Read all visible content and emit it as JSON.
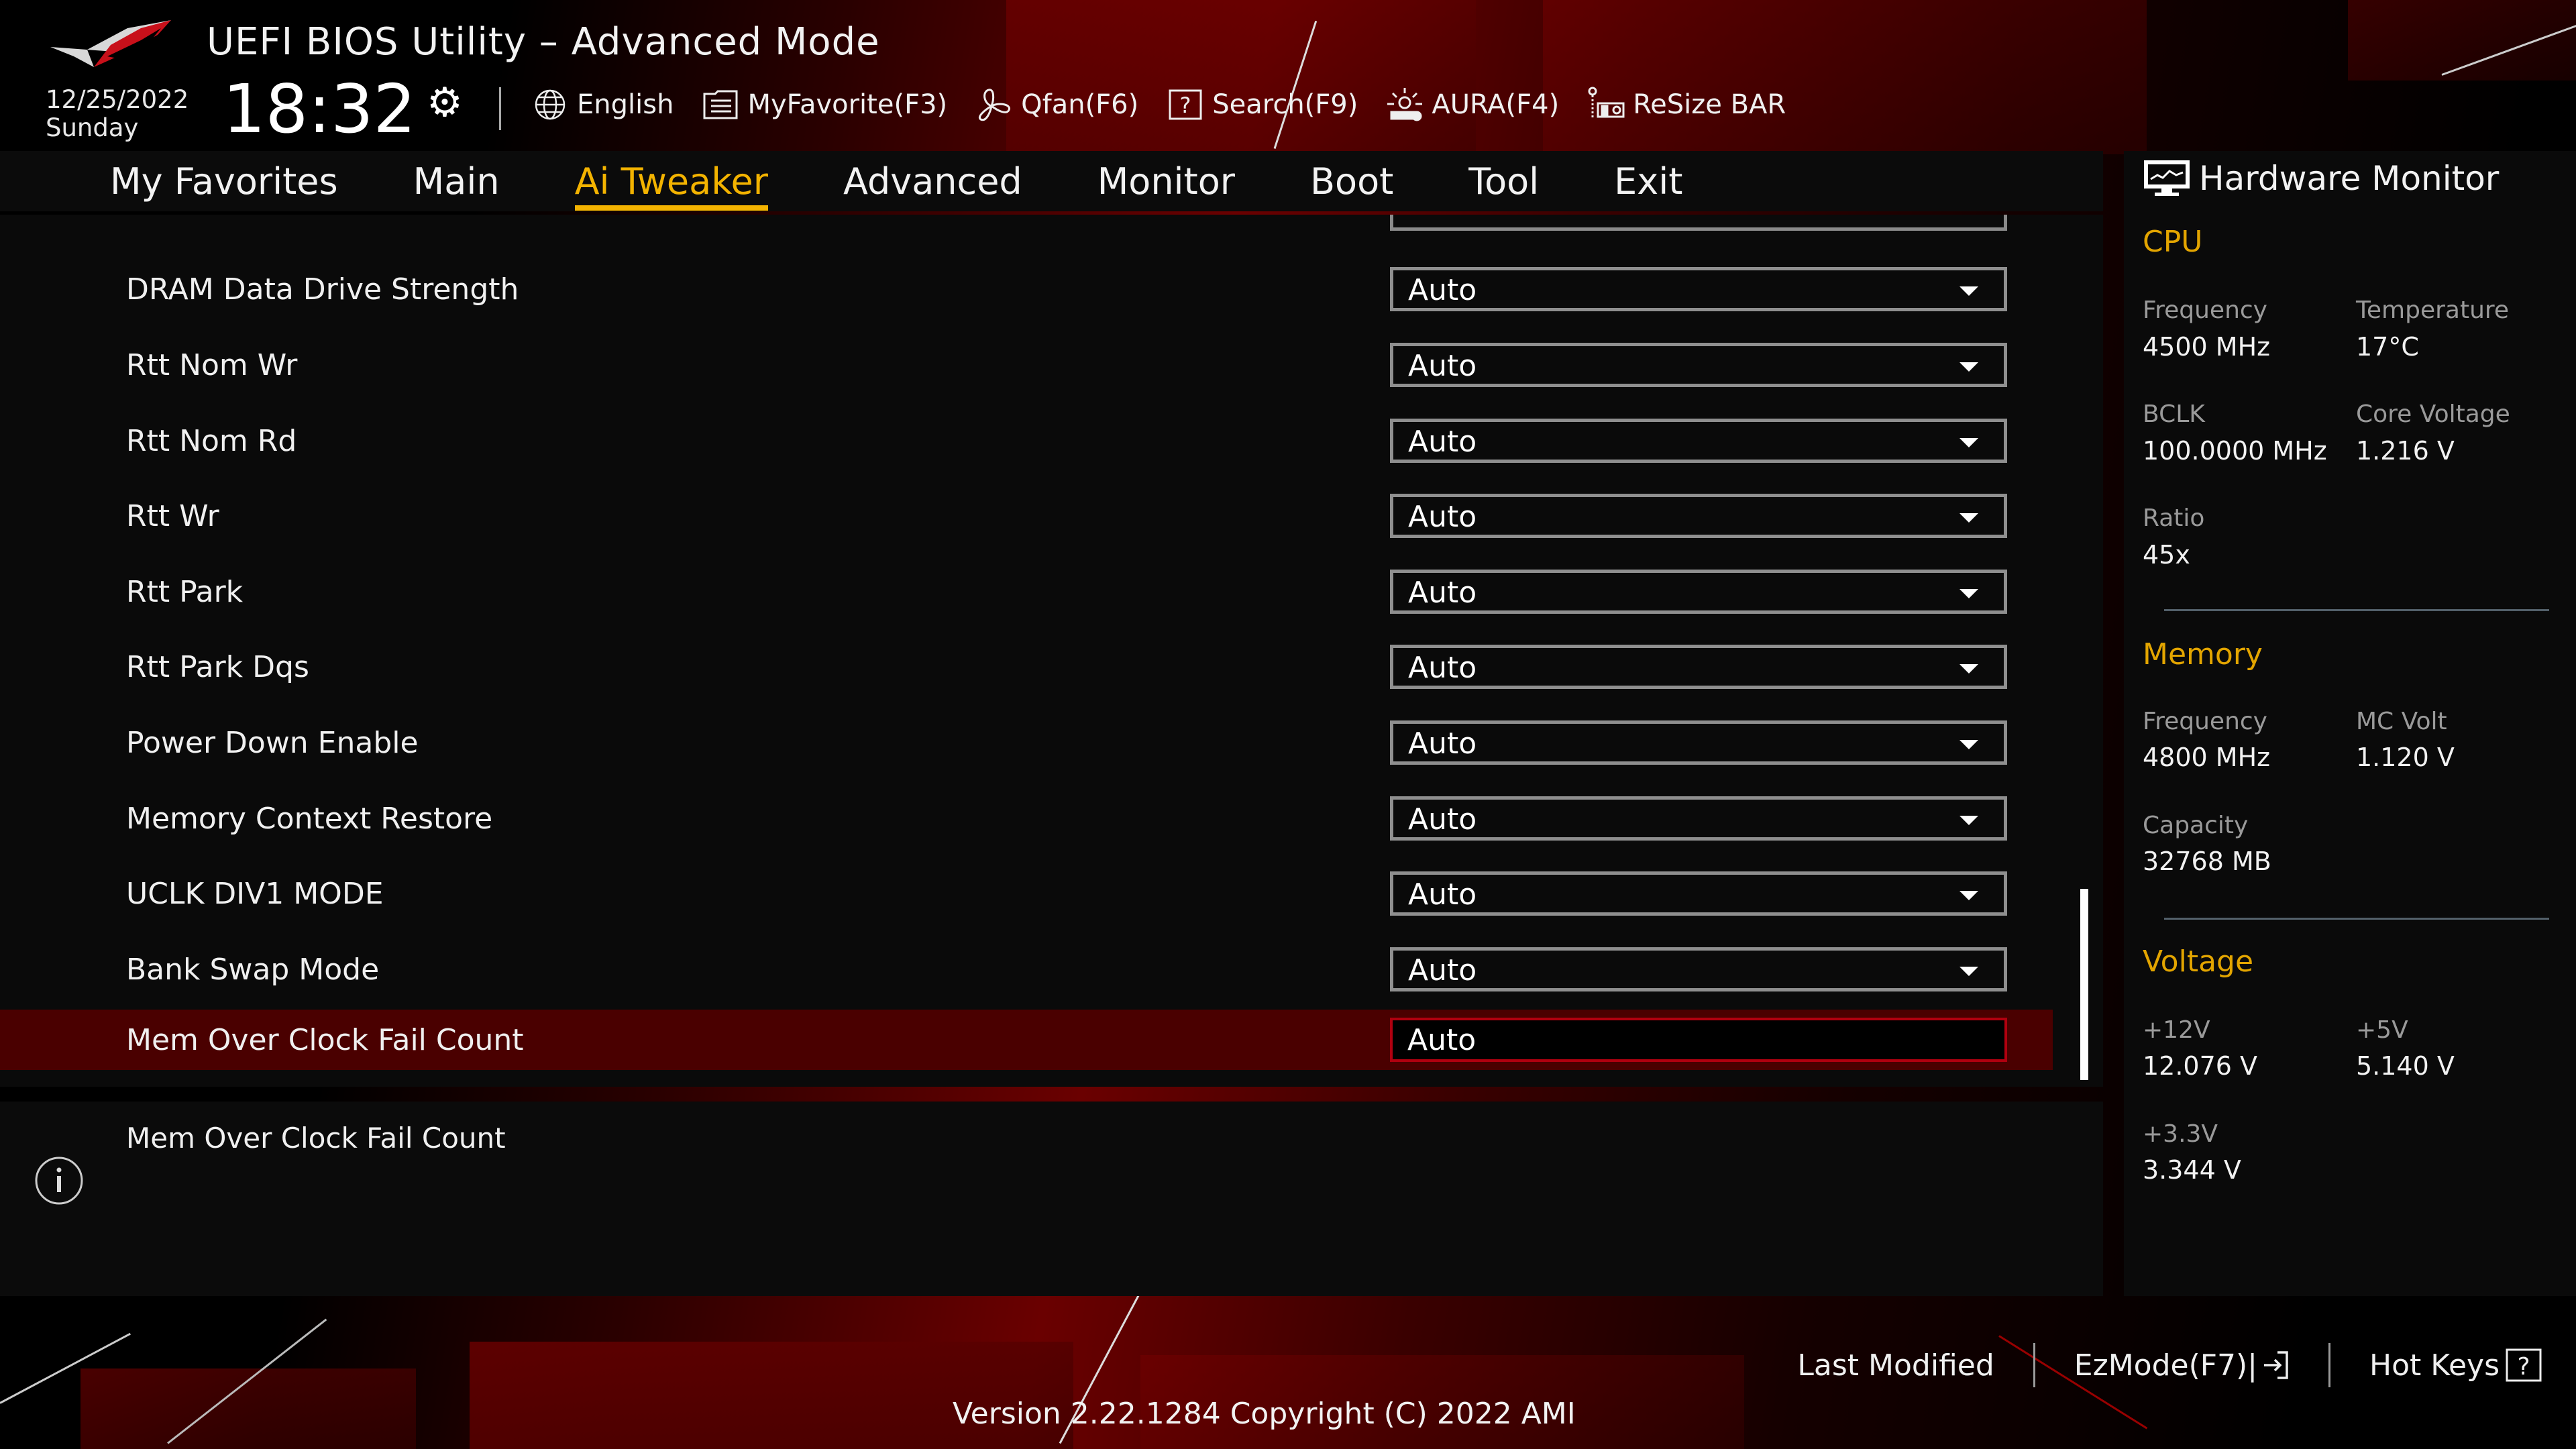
{
  "header": {
    "title": "UEFI BIOS Utility – Advanced Mode",
    "date": "12/25/2022",
    "day": "Sunday",
    "time": "18:32",
    "toolbar": [
      {
        "label": "English",
        "icon": "globe-icon"
      },
      {
        "label": "MyFavorite(F3)",
        "icon": "favorite-list-icon"
      },
      {
        "label": "Qfan(F6)",
        "icon": "fan-icon"
      },
      {
        "label": "Search(F9)",
        "icon": "search-help-icon"
      },
      {
        "label": "AURA(F4)",
        "icon": "aura-light-icon"
      },
      {
        "label": "ReSize BAR",
        "icon": "resize-bar-icon"
      }
    ]
  },
  "nav": {
    "tabs": [
      {
        "label": "My Favorites",
        "active": false
      },
      {
        "label": "Main",
        "active": false
      },
      {
        "label": "Ai Tweaker",
        "active": true
      },
      {
        "label": "Advanced",
        "active": false
      },
      {
        "label": "Monitor",
        "active": false
      },
      {
        "label": "Boot",
        "active": false
      },
      {
        "label": "Tool",
        "active": false
      },
      {
        "label": "Exit",
        "active": false
      }
    ]
  },
  "settings": [
    {
      "label": "DRAM Data Drive Strength",
      "value": "Auto",
      "type": "dropdown"
    },
    {
      "label": "Rtt Nom Wr",
      "value": "Auto",
      "type": "dropdown"
    },
    {
      "label": "Rtt Nom Rd",
      "value": "Auto",
      "type": "dropdown"
    },
    {
      "label": "Rtt Wr",
      "value": "Auto",
      "type": "dropdown"
    },
    {
      "label": "Rtt Park",
      "value": "Auto",
      "type": "dropdown"
    },
    {
      "label": "Rtt Park Dqs",
      "value": "Auto",
      "type": "dropdown"
    },
    {
      "label": "Power Down Enable",
      "value": "Auto",
      "type": "dropdown"
    },
    {
      "label": "Memory Context Restore",
      "value": "Auto",
      "type": "dropdown"
    },
    {
      "label": "UCLK DIV1 MODE",
      "value": "Auto",
      "type": "dropdown"
    },
    {
      "label": "Bank Swap Mode",
      "value": "Auto",
      "type": "dropdown"
    },
    {
      "label": "Mem Over Clock Fail Count",
      "value": "Auto",
      "type": "input",
      "selected": true
    }
  ],
  "help": {
    "text": "Mem Over Clock Fail Count"
  },
  "hardware_monitor": {
    "title": "Hardware Monitor",
    "cpu": {
      "heading": "CPU",
      "frequency_label": "Frequency",
      "frequency": "4500 MHz",
      "temperature_label": "Temperature",
      "temperature": "17°C",
      "bclk_label": "BCLK",
      "bclk": "100.0000 MHz",
      "core_voltage_label": "Core Voltage",
      "core_voltage": "1.216 V",
      "ratio_label": "Ratio",
      "ratio": "45x"
    },
    "memory": {
      "heading": "Memory",
      "frequency_label": "Frequency",
      "frequency": "4800 MHz",
      "mc_volt_label": "MC Volt",
      "mc_volt": "1.120 V",
      "capacity_label": "Capacity",
      "capacity": "32768 MB"
    },
    "voltage": {
      "heading": "Voltage",
      "v12_label": "+12V",
      "v12": "12.076 V",
      "v5_label": "+5V",
      "v5": "5.140 V",
      "v33_label": "+3.3V",
      "v33": "3.344 V"
    }
  },
  "footer": {
    "last_modified": "Last Modified",
    "ezmode": "EzMode(F7)|",
    "hotkeys": "Hot Keys",
    "version": "Version 2.22.1284 Copyright (C) 2022 AMI"
  },
  "colors": {
    "accent": "#f3b300",
    "selected_row": "#4a0000",
    "selected_border": "#b0000f"
  }
}
